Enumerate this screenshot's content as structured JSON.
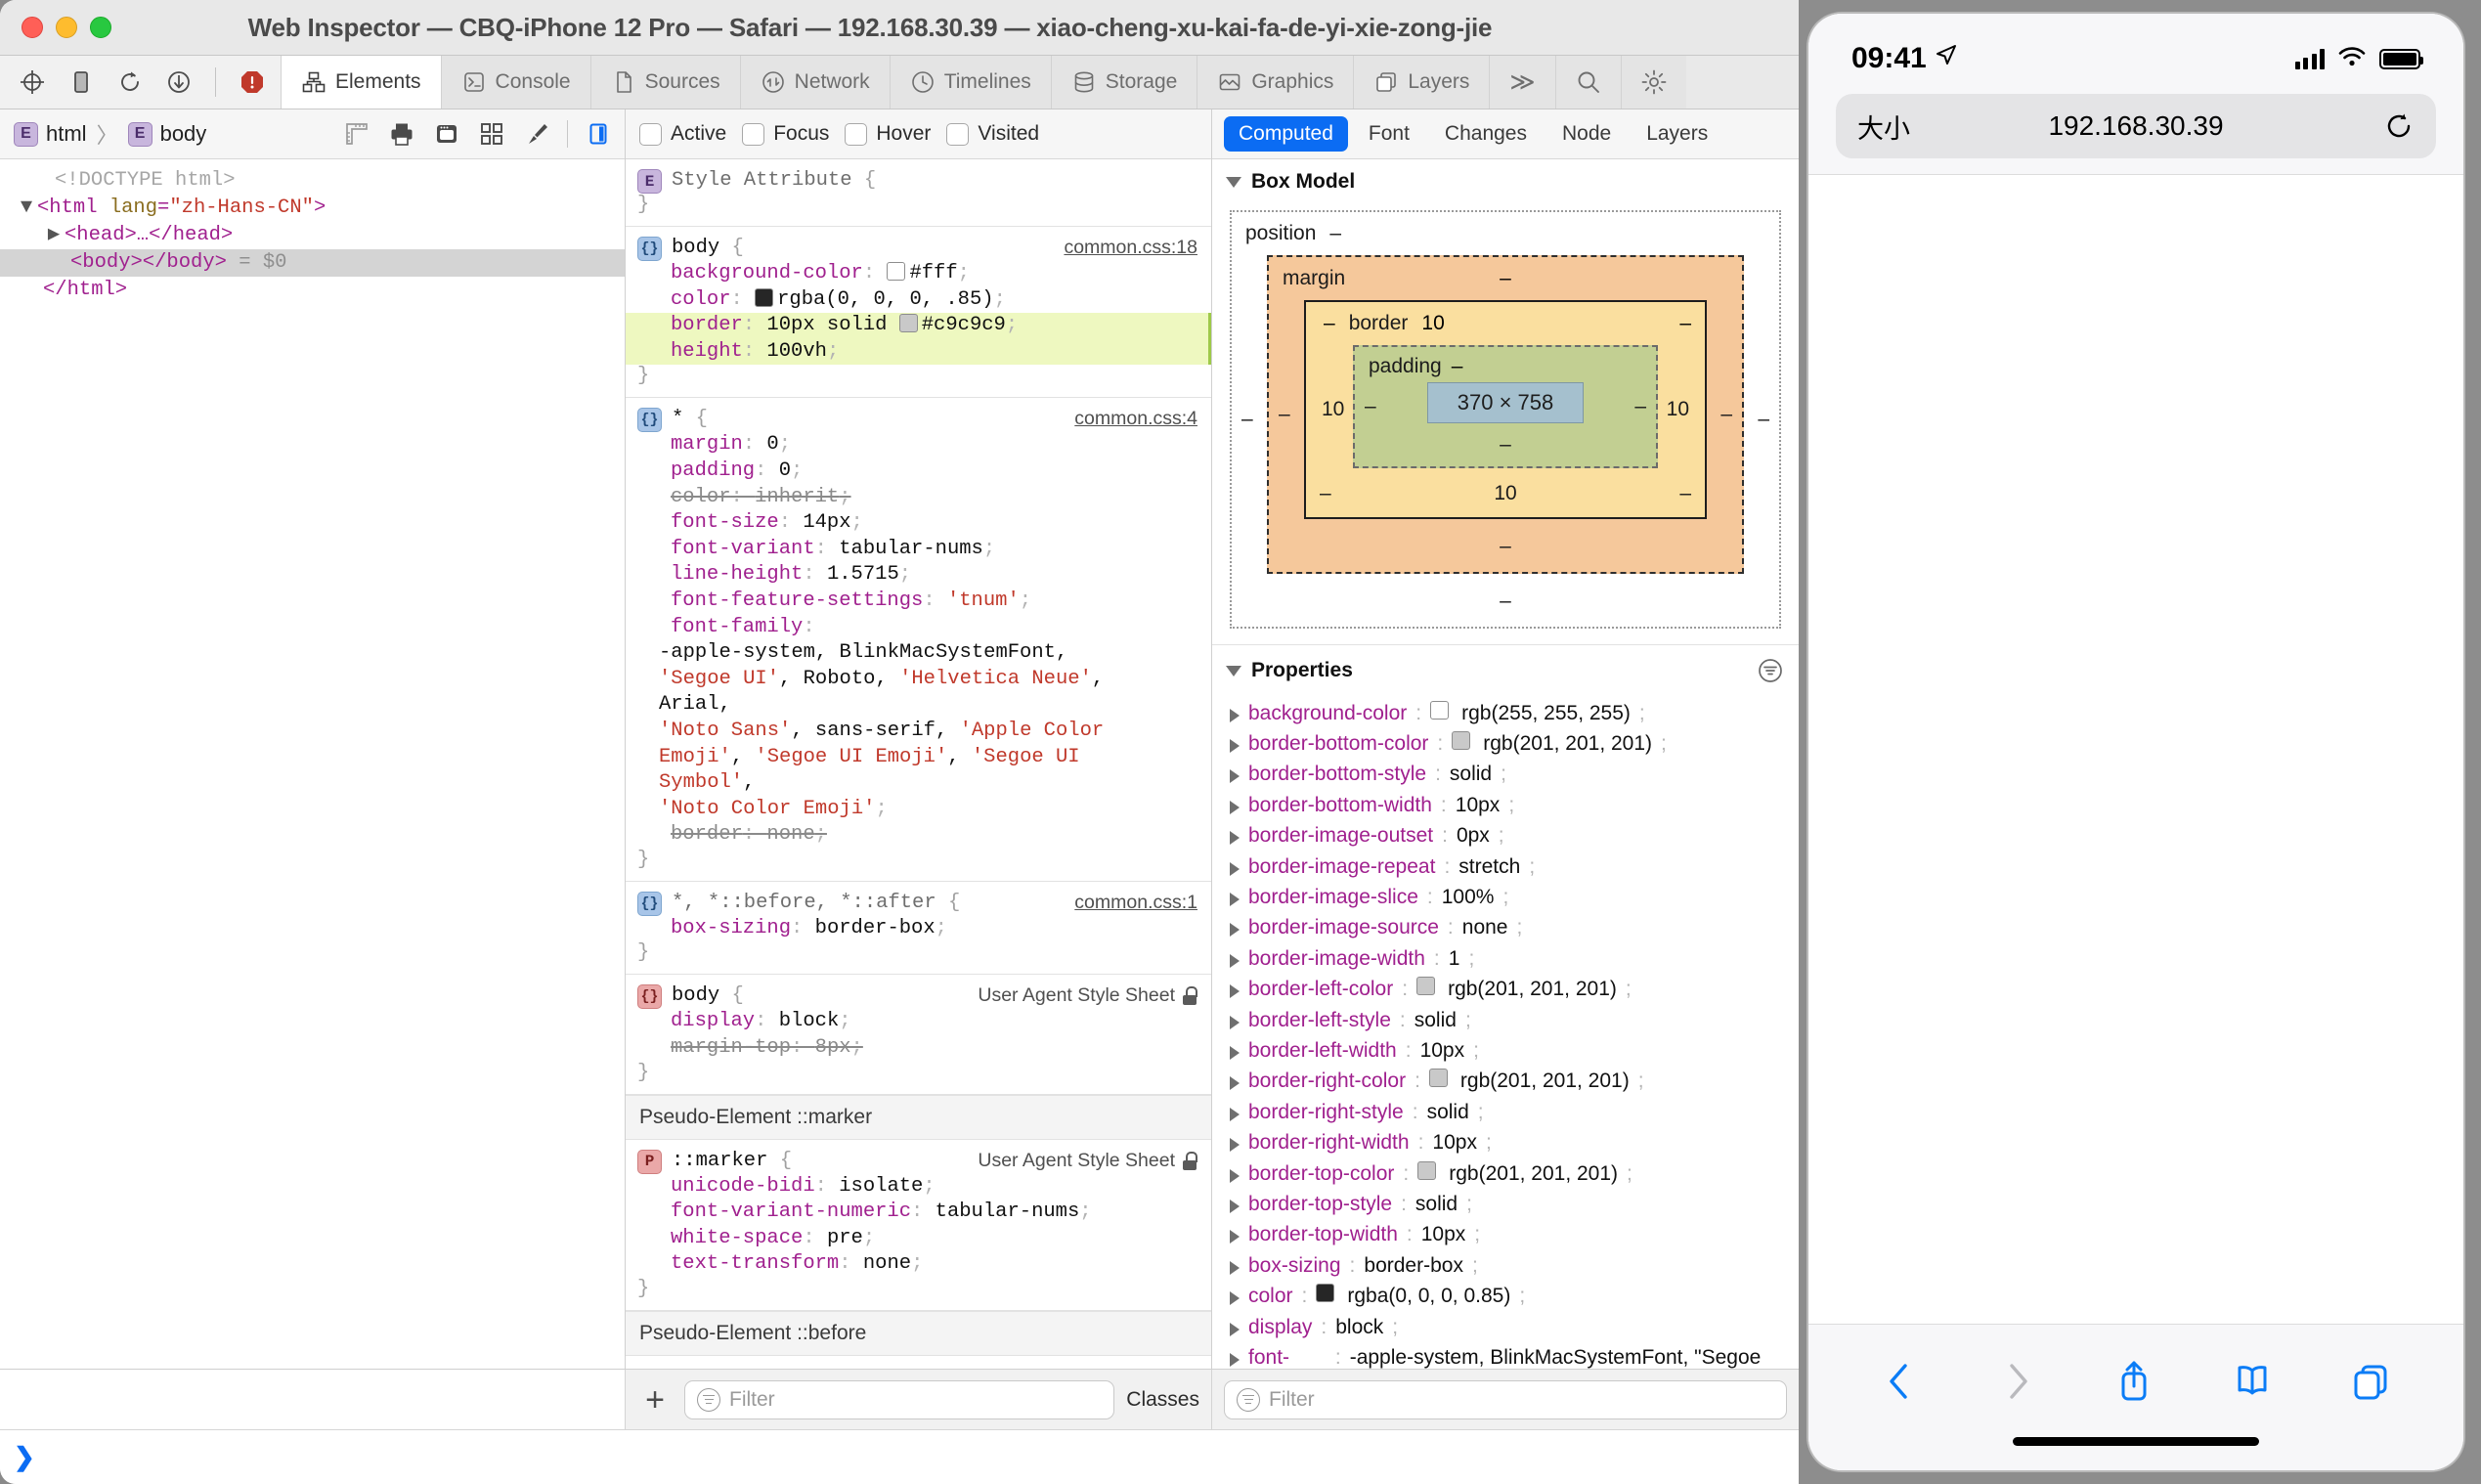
{
  "window": {
    "title": "Web Inspector — CBQ-iPhone 12 Pro — Safari — 192.168.30.39 — xiao-cheng-xu-kai-fa-de-yi-xie-zong-jie"
  },
  "toolbar": {
    "left_icons": [
      "inspect-element-icon",
      "device-icon",
      "reload-icon",
      "download-icon",
      "error-icon"
    ],
    "tabs": [
      {
        "label": "Elements",
        "icon": "elements-icon",
        "active": true
      },
      {
        "label": "Console",
        "icon": "console-icon",
        "active": false
      },
      {
        "label": "Sources",
        "icon": "sources-icon",
        "active": false
      },
      {
        "label": "Network",
        "icon": "network-icon",
        "active": false
      },
      {
        "label": "Timelines",
        "icon": "timelines-icon",
        "active": false
      },
      {
        "label": "Storage",
        "icon": "storage-icon",
        "active": false
      },
      {
        "label": "Graphics",
        "icon": "graphics-icon",
        "active": false
      },
      {
        "label": "Layers",
        "icon": "layers-icon",
        "active": false
      }
    ],
    "overflow_label": "≫",
    "search_icon": "search-icon",
    "settings_icon": "gear-icon"
  },
  "dom_pane": {
    "breadcrumb": [
      {
        "badge": "E",
        "label": "html"
      },
      {
        "badge": "E",
        "label": "body"
      }
    ],
    "breadcrumb_separator": "〉",
    "tools": [
      "ruler-icon",
      "print-icon",
      "layers-window-icon",
      "grid-icon",
      "paintbrush-icon",
      "sidebar-toggle-icon"
    ],
    "tree": [
      {
        "indent": 1,
        "twisty": "",
        "parts": [
          {
            "t": "<!DOCTYPE html>",
            "c": "c-doctype"
          }
        ]
      },
      {
        "indent": 0,
        "twisty": "▼",
        "parts": [
          {
            "t": "<html ",
            "c": "c-tag"
          },
          {
            "t": "lang",
            "c": "c-attr"
          },
          {
            "t": "=",
            "c": "c-tag"
          },
          {
            "t": "\"zh-Hans-CN\"",
            "c": "c-val"
          },
          {
            "t": ">",
            "c": "c-tag"
          }
        ]
      },
      {
        "indent": 1,
        "twisty": "▶",
        "parts": [
          {
            "t": "<head>…</head>",
            "c": "c-tag"
          }
        ]
      },
      {
        "indent": 2,
        "twisty": "",
        "selected": true,
        "parts": [
          {
            "t": "<body></body>",
            "c": "c-tag"
          },
          {
            "t": " = $0",
            "c": "c-gray"
          }
        ]
      },
      {
        "indent": 1,
        "twisty": "",
        "parts": [
          {
            "t": "</html>",
            "c": "c-tag"
          }
        ]
      }
    ]
  },
  "styles_pane": {
    "pseudo_states": [
      "Active",
      "Focus",
      "Hover",
      "Visited"
    ],
    "rules": [
      {
        "badge": "E",
        "badge_kind": "element",
        "selector": "Style Attribute",
        "selector_dim": true,
        "origin": "",
        "declarations": []
      },
      {
        "badge": "{}",
        "badge_kind": "css",
        "selector": "body",
        "origin": "common.css:18",
        "origin_link": true,
        "declarations": [
          {
            "prop": "background-color",
            "value": "#fff",
            "swatch": "#ffffff"
          },
          {
            "prop": "color",
            "value": "rgba(0, 0, 0, .85)",
            "swatch": "#262626"
          },
          {
            "prop": "border",
            "value": "10px solid #c9c9c9",
            "swatch": "#c9c9c9",
            "swatch_before": "#c9c9c9",
            "highlight": true,
            "value_pre": "10px solid ",
            "value_post": "#c9c9c9"
          },
          {
            "prop": "height",
            "value": "100vh",
            "highlight": true
          }
        ]
      },
      {
        "badge": "{}",
        "badge_kind": "css",
        "selector": "*",
        "origin": "common.css:4",
        "origin_link": true,
        "declarations": [
          {
            "prop": "margin",
            "value": "0"
          },
          {
            "prop": "padding",
            "value": "0"
          },
          {
            "prop": "color",
            "value": "inherit",
            "strike": true
          },
          {
            "prop": "font-size",
            "value": "14px"
          },
          {
            "prop": "font-variant",
            "value": "tabular-nums"
          },
          {
            "prop": "line-height",
            "value": "1.5715"
          },
          {
            "prop": "font-feature-settings",
            "value": "'tnum'",
            "string": true
          },
          {
            "prop": "font-family",
            "value": ""
          },
          {
            "raw": "-apple-system, BlinkMacSystemFont,"
          },
          {
            "raw2": [
              {
                "t": "'Segoe UI'",
                "c": "pstr"
              },
              {
                "t": ", Roboto, ",
                "c": "pval"
              },
              {
                "t": "'Helvetica Neue'",
                "c": "pstr"
              },
              {
                "t": ",",
                "c": "pval"
              }
            ]
          },
          {
            "raw": "Arial,"
          },
          {
            "raw2": [
              {
                "t": "'Noto Sans'",
                "c": "pstr"
              },
              {
                "t": ", sans-serif, ",
                "c": "pval"
              },
              {
                "t": "'Apple Color",
                "c": "pstr"
              }
            ]
          },
          {
            "raw2": [
              {
                "t": "Emoji'",
                "c": "pstr"
              },
              {
                "t": ", ",
                "c": "pval"
              },
              {
                "t": "'Segoe UI Emoji'",
                "c": "pstr"
              },
              {
                "t": ", ",
                "c": "pval"
              },
              {
                "t": "'Segoe UI",
                "c": "pstr"
              }
            ]
          },
          {
            "raw2": [
              {
                "t": "Symbol'",
                "c": "pstr"
              },
              {
                "t": ",",
                "c": "pval"
              }
            ]
          },
          {
            "raw2": [
              {
                "t": "'Noto Color Emoji'",
                "c": "pstr"
              },
              {
                "t": ";",
                "c": "semi"
              }
            ]
          },
          {
            "prop": "border",
            "value": "none",
            "strike": true
          }
        ]
      },
      {
        "badge": "{}",
        "badge_kind": "css",
        "selector": "*, *::before, *::after",
        "selector_dim": true,
        "origin": "common.css:1",
        "origin_link": true,
        "declarations": [
          {
            "prop": "box-sizing",
            "value": "border-box"
          }
        ]
      },
      {
        "badge": "{}",
        "badge_kind": "css-ua",
        "selector": "body",
        "origin": "User Agent Style Sheet",
        "origin_link": false,
        "locked": true,
        "declarations": [
          {
            "prop": "display",
            "value": "block"
          },
          {
            "prop": "margin-top",
            "value": "8px",
            "strike": true
          }
        ]
      }
    ],
    "pseudo_marker_header": "Pseudo-Element ::marker",
    "marker_rule": {
      "badge": "P",
      "selector": "::marker",
      "origin": "User Agent Style Sheet",
      "locked": true,
      "declarations": [
        {
          "prop": "unicode-bidi",
          "value": "isolate"
        },
        {
          "prop": "font-variant-numeric",
          "value": "tabular-nums"
        },
        {
          "prop": "white-space",
          "value": "pre"
        },
        {
          "prop": "text-transform",
          "value": "none"
        }
      ]
    },
    "pseudo_before_header": "Pseudo-Element ::before"
  },
  "computed_pane": {
    "tabs": [
      {
        "label": "Computed",
        "active": true
      },
      {
        "label": "Font",
        "active": false
      },
      {
        "label": "Changes",
        "active": false
      },
      {
        "label": "Node",
        "active": false
      },
      {
        "label": "Layers",
        "active": false
      }
    ],
    "box_model": {
      "title": "Box Model",
      "position_label": "position",
      "position_top": "–",
      "position_left": "–",
      "position_right": "–",
      "position_bottom": "–",
      "margin_label": "margin",
      "margin_top": "–",
      "margin_left": "–",
      "margin_right": "–",
      "margin_bottom": "–",
      "border_label": "border",
      "border_top": "10",
      "border_left": "10",
      "border_right": "10",
      "border_bottom": "10",
      "border_corner_tl": "–",
      "border_corner_tr": "–",
      "border_corner_bl": "–",
      "border_corner_br": "–",
      "padding_label": "padding",
      "padding_top": "–",
      "padding_left": "–",
      "padding_right": "–",
      "padding_bottom": "–",
      "content_size": "370 × 758"
    },
    "properties_title": "Properties",
    "properties": [
      {
        "name": "background-color",
        "value": "rgb(255, 255, 255)",
        "swatch": "#ffffff"
      },
      {
        "name": "border-bottom-color",
        "value": "rgb(201, 201, 201)",
        "swatch": "#c9c9c9"
      },
      {
        "name": "border-bottom-style",
        "value": "solid"
      },
      {
        "name": "border-bottom-width",
        "value": "10px"
      },
      {
        "name": "border-image-outset",
        "value": "0px"
      },
      {
        "name": "border-image-repeat",
        "value": "stretch"
      },
      {
        "name": "border-image-slice",
        "value": "100%"
      },
      {
        "name": "border-image-source",
        "value": "none"
      },
      {
        "name": "border-image-width",
        "value": "1"
      },
      {
        "name": "border-left-color",
        "value": "rgb(201, 201, 201)",
        "swatch": "#c9c9c9"
      },
      {
        "name": "border-left-style",
        "value": "solid"
      },
      {
        "name": "border-left-width",
        "value": "10px"
      },
      {
        "name": "border-right-color",
        "value": "rgb(201, 201, 201)",
        "swatch": "#c9c9c9"
      },
      {
        "name": "border-right-style",
        "value": "solid"
      },
      {
        "name": "border-right-width",
        "value": "10px"
      },
      {
        "name": "border-top-color",
        "value": "rgb(201, 201, 201)",
        "swatch": "#c9c9c9"
      },
      {
        "name": "border-top-style",
        "value": "solid"
      },
      {
        "name": "border-top-width",
        "value": "10px"
      },
      {
        "name": "box-sizing",
        "value": "border-box"
      },
      {
        "name": "color",
        "value": "rgba(0, 0, 0, 0.85)",
        "swatch": "#262626"
      },
      {
        "name": "display",
        "value": "block"
      },
      {
        "name": "font-family",
        "value": "-apple-system, BlinkMacSystemFont, \"Segoe UI\", Roboto,",
        "wrap": true
      }
    ]
  },
  "bottom_bar": {
    "add_label": "+",
    "styles_filter_placeholder": "Filter",
    "classes_label": "Classes",
    "computed_filter_placeholder": "Filter"
  },
  "console_prompt": {
    "chevron": "❯"
  },
  "phone": {
    "status": {
      "time": "09:41",
      "location_icon": "location-arrow-icon",
      "signal_icon": "cellular-bars-icon",
      "wifi_icon": "wifi-icon",
      "battery_icon": "battery-icon"
    },
    "urlbar": {
      "size_label": "大小",
      "host": "192.168.30.39",
      "reload_icon": "reload-icon"
    },
    "toolbar_icons": [
      "back-icon",
      "forward-icon",
      "share-icon",
      "bookmarks-icon",
      "tabs-icon"
    ]
  },
  "colors": {
    "accent": "#0b6cf3",
    "highlight": "#eef8c0",
    "property": "#a0208e",
    "string": "#c0392b",
    "safari_blue": "#0b7cf6"
  }
}
